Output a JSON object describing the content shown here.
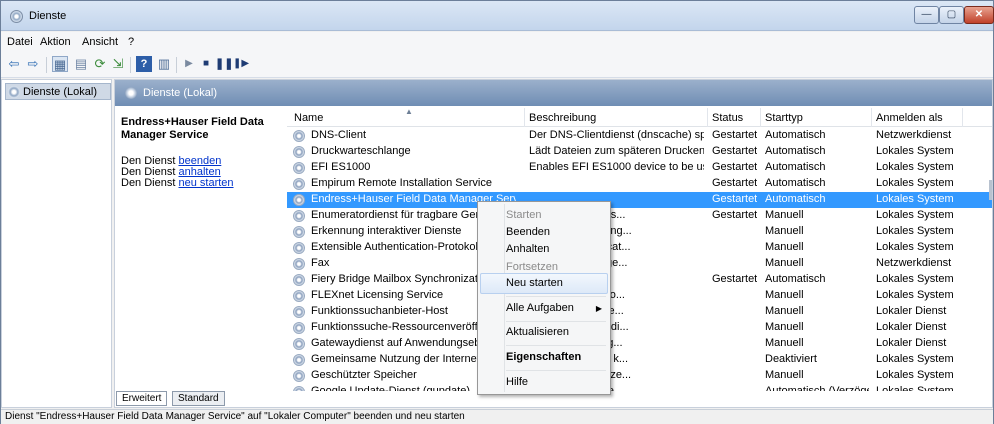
{
  "window": {
    "title": "Dienste",
    "controls": [
      "—",
      "▢",
      "✕"
    ]
  },
  "menu": [
    "Datei",
    "Aktion",
    "Ansicht",
    "?"
  ],
  "toolbar": [
    "back-icon",
    "forward-icon",
    "console-tree-icon",
    "properties-icon",
    "refresh-icon",
    "export-icon",
    "help-icon",
    "show-hide-icon",
    "play-icon",
    "stop-icon",
    "pause-icon",
    "restart-icon"
  ],
  "tree": {
    "label": "Dienste (Lokal)"
  },
  "pane": {
    "title": "Dienste (Lokal)"
  },
  "description": {
    "service_name": "Endress+Hauser Field Data Manager Service",
    "line1_prefix": "Den Dienst ",
    "line1_link": "beenden",
    "line2_prefix": "Den Dienst ",
    "line2_link": "anhalten",
    "line3_prefix": "Den Dienst ",
    "line3_link": "neu starten"
  },
  "columns": [
    "Name",
    "Beschreibung",
    "Status",
    "Starttyp",
    "Anmelden als"
  ],
  "rows": [
    {
      "name": "DNS-Client",
      "desc": "Der DNS-Clientdienst (dnscache) speic...",
      "status": "Gestartet",
      "start": "Automatisch",
      "logon": "Netzwerkdienst"
    },
    {
      "name": "Druckwarteschlange",
      "desc": "Lädt Dateien zum späteren Drucken in ...",
      "status": "Gestartet",
      "start": "Automatisch",
      "logon": "Lokales System"
    },
    {
      "name": "EFI ES1000",
      "desc": "Enables EFI ES1000 device to be used fr...",
      "status": "Gestartet",
      "start": "Automatisch",
      "logon": "Lokales System"
    },
    {
      "name": "Empirum Remote Installation Service",
      "desc": "",
      "status": "Gestartet",
      "start": "Automatisch",
      "logon": "Lokales System"
    },
    {
      "name": "Endress+Hauser Field Data Manager Servi",
      "desc": "",
      "status": "Gestartet",
      "start": "Automatisch",
      "logon": "Lokales System",
      "selected": true
    },
    {
      "name": "Enumeratordienst für tragbare Geräte",
      "desc": "htlinien für Wechs...",
      "status": "Gestartet",
      "start": "Manuell",
      "logon": "Lokales System"
    },
    {
      "name": "Erkennung interaktiver Dienste",
      "desc": "erbenachrichtigung...",
      "status": "",
      "start": "Manuell",
      "logon": "Lokales System"
    },
    {
      "name": "Extensible Authentication-Protokoll",
      "desc": "ensible Authenticat...",
      "status": "",
      "start": "Manuell",
      "logon": "Lokales System"
    },
    {
      "name": "Fax",
      "desc": "len und Empfange...",
      "status": "",
      "start": "Manuell",
      "logon": "Netzwerkdienst"
    },
    {
      "name": "Fiery Bridge Mailbox Synchronization",
      "desc": "",
      "status": "Gestartet",
      "start": "Automatisch",
      "logon": "Lokales System"
    },
    {
      "name": "FLEXnet Licensing Service",
      "desc": "s licensing functio...",
      "status": "",
      "start": "Manuell",
      "logon": "Lokales System"
    },
    {
      "name": "Funktionssuchanbieter-Host",
      "desc": "t dient zum Hoste...",
      "status": "",
      "start": "Manuell",
      "logon": "Lokaler Dienst"
    },
    {
      "name": "Funktionssuche-Ressourcenveröffentlic",
      "desc": "n Computer und di...",
      "status": "",
      "start": "Manuell",
      "logon": "Lokaler Dienst"
    },
    {
      "name": "Gatewaydienst auf Anwendungsebene",
      "desc": "für Protokoll-Plug...",
      "status": "",
      "start": "Manuell",
      "logon": "Lokaler Dienst"
    },
    {
      "name": "Gemeinsame Nutzung der Internetverbi",
      "desc": "ern in Heim- und k...",
      "status": "",
      "start": "Deaktiviert",
      "logon": "Lokales System"
    },
    {
      "name": "Geschützter Speicher",
      "desc": "peicher für schütze...",
      "status": "",
      "start": "Manuell",
      "logon": "Lokales System"
    },
    {
      "name": "Google Update-Dienst (gupdate)",
      "desc": "tware auf dem ne...",
      "status": "",
      "start": "Automatisch (Verzöge...",
      "logon": "Lokales System"
    }
  ],
  "tabs": [
    "Erweitert",
    "Standard"
  ],
  "context_menu": {
    "starten": "Starten",
    "beenden": "Beenden",
    "anhalten": "Anhalten",
    "fortsetzen": "Fortsetzen",
    "neu_starten": "Neu starten",
    "alle_aufgaben": "Alle Aufgaben",
    "aktualisieren": "Aktualisieren",
    "eigenschaften": "Eigenschaften",
    "hilfe": "Hilfe"
  },
  "statusbar": "Dienst \"Endress+Hauser Field Data Manager Service\" auf \"Lokaler Computer\" beenden und neu starten"
}
